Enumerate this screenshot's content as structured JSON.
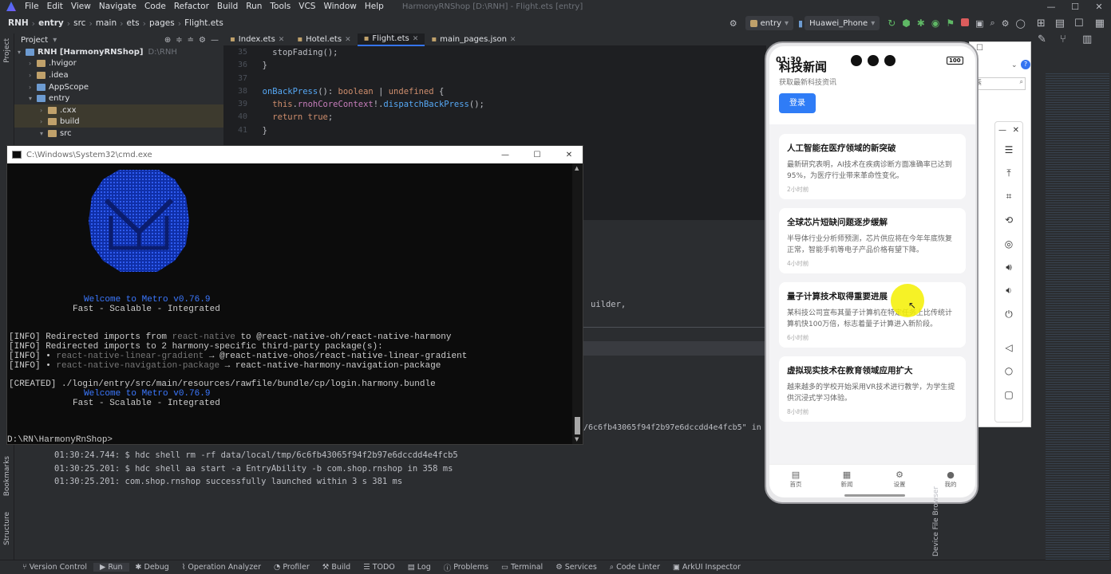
{
  "menubar": {
    "items": [
      "File",
      "Edit",
      "View",
      "Navigate",
      "Code",
      "Refactor",
      "Build",
      "Run",
      "Tools",
      "VCS",
      "Window",
      "Help"
    ],
    "title": "HarmonyRNShop [D:\\RNH] - Flight.ets [entry]"
  },
  "toolbar": {
    "crumbs": [
      "RNH",
      "entry",
      "src",
      "main",
      "ets",
      "pages",
      "Flight.ets"
    ],
    "module": "entry",
    "device": "Huawei_Phone"
  },
  "left_stripe": {
    "project": "Project",
    "bookmarks": "Bookmarks",
    "structure": "Structure"
  },
  "project_panel": {
    "title": "Project",
    "items": [
      {
        "label": "RNH [HarmonyRNShop]",
        "extra": "D:\\RNH"
      },
      {
        "label": ".hvigor"
      },
      {
        "label": ".idea"
      },
      {
        "label": "AppScope"
      },
      {
        "label": "entry"
      },
      {
        "label": ".cxx"
      },
      {
        "label": "build"
      },
      {
        "label": "src"
      }
    ]
  },
  "editor": {
    "tabs": [
      "Index.ets",
      "Hotel.ets",
      "Flight.ets",
      "main_pages.json"
    ],
    "line_numbers": [
      "35",
      "36",
      "37",
      "38",
      "39",
      "40",
      "41"
    ],
    "fragment_right": "uilder,",
    "fragment_hash": "/6c6fb43065f94f2b97e6dccdd4e4fcb5\" in"
  },
  "cmd": {
    "title": "C:\\Windows\\System32\\cmd.exe",
    "welcome1": "Welcome to Metro v0.76.9",
    "tagline1": "Fast - Scalable - Integrated",
    "info1_a": "[INFO] Redirected imports from ",
    "info1_b": "react-native",
    "info1_c": " to @react-native-oh/react-native-harmony",
    "info2": "[INFO] Redirected imports to 2 harmony-specific third-party package(s):",
    "info3_a": "[INFO] • ",
    "info3_b": "react-native-linear-gradient",
    "info3_c": " → @react-native-ohos/react-native-linear-gradient",
    "info4_a": "[INFO] • ",
    "info4_b": "react-native-navigation-package",
    "info4_c": " → react-native-harmony-navigation-package",
    "created": "[CREATED] ./login/entry/src/main/resources/rawfile/bundle/cp/login.harmony.bundle",
    "welcome2": "Welcome to Metro v0.76.9",
    "tagline2": "Fast - Scalable - Integrated",
    "prompt": "D:\\RN\\HarmonyRnShop>"
  },
  "run_log": [
    "01:30:24.744: $ hdc shell rm -rf data/local/tmp/6c6fb43065f94f2b97e6dccdd4e4fcb5",
    "01:30:25.201: $ hdc shell aa start -a EntryAbility -b com.shop.rnshop in 358 ms",
    "01:30:25.201: com.shop.rnshop successfully launched within 3 s 381 ms"
  ],
  "phone": {
    "time": "01:30",
    "battery": "100",
    "app_title": "科技新闻",
    "subtitle": "获取最新科技资讯",
    "login_button": "登录",
    "news": [
      {
        "title": "人工智能在医疗领域的新突破",
        "body": "最新研究表明，AI技术在疾病诊断方面准确率已达到95%，为医疗行业带来革命性变化。",
        "time": "2小时前"
      },
      {
        "title": "全球芯片短缺问题逐步缓解",
        "body": "半导体行业分析师预测，芯片供应将在今年年底恢复正常，智能手机等电子产品价格有望下降。",
        "time": "4小时前"
      },
      {
        "title": "量子计算技术取得重要进展",
        "body": "某科技公司宣布其量子计算机在特定任务上比传统计算机快100万倍，标志着量子计算进入新阶段。",
        "time": "6小时前"
      },
      {
        "title": "虚拟现实技术在教育领域应用扩大",
        "body": "越来越多的学校开始采用VR技术进行教学，为学生提供沉浸式学习体验。",
        "time": "8小时前"
      }
    ],
    "tabs": [
      "首页",
      "新闻",
      "设置",
      "我的"
    ]
  },
  "bottom_bar": [
    "Version Control",
    "Run",
    "Debug",
    "Operation Analyzer",
    "Profiler",
    "Build",
    "TODO",
    "Log",
    "Problems",
    "Terminal",
    "Services",
    "Code Linter",
    "ArkUI Inspector"
  ],
  "device_file_browser": "Device File Browser",
  "colors": {
    "accent": "#3574f0",
    "phone_button": "#2f7cf6",
    "cursor_highlight": "#f5f000"
  }
}
